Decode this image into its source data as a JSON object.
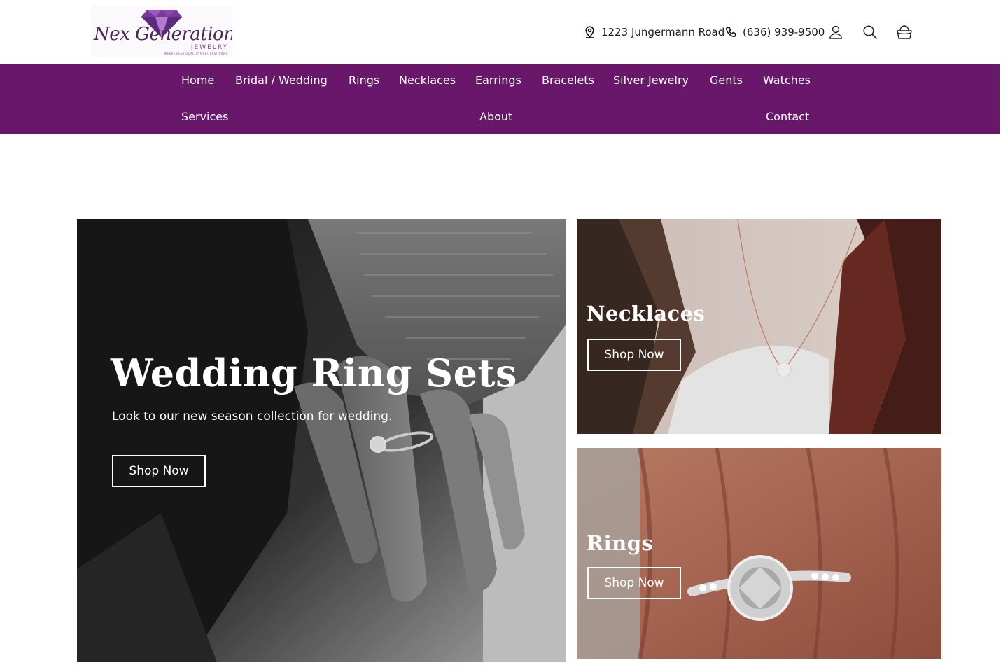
{
  "header": {
    "logo_text": "Nex Generation",
    "logo_sub": "JEWELRY",
    "logo_tag": "WHERE BEST QUALITY MEET BEST PRICE",
    "address": "1223 Jungermann Road",
    "phone": "(636) 939-9500",
    "icons": [
      "location-pin-icon",
      "phone-icon",
      "account-icon",
      "search-icon",
      "cart-icon"
    ]
  },
  "nav": {
    "items": [
      {
        "label": "Home",
        "active": true
      },
      {
        "label": "Bridal / Wedding"
      },
      {
        "label": "Rings"
      },
      {
        "label": "Necklaces"
      },
      {
        "label": "Earrings"
      },
      {
        "label": "Bracelets"
      },
      {
        "label": "Silver Jewelry"
      },
      {
        "label": "Gents"
      },
      {
        "label": "Watches"
      },
      {
        "label": "Services"
      },
      {
        "label": "About"
      },
      {
        "label": "Contact"
      }
    ]
  },
  "hero": {
    "title": "Wedding Ring Sets",
    "subtitle": "Look to our new season collection for wedding.",
    "button": "Shop Now"
  },
  "tiles": [
    {
      "title": "Necklaces",
      "button": "Shop Now"
    },
    {
      "title": "Rings",
      "button": "Shop Now"
    }
  ],
  "colors": {
    "nav_bg": "#69176b",
    "text_dark": "#121212",
    "white": "#ffffff"
  }
}
